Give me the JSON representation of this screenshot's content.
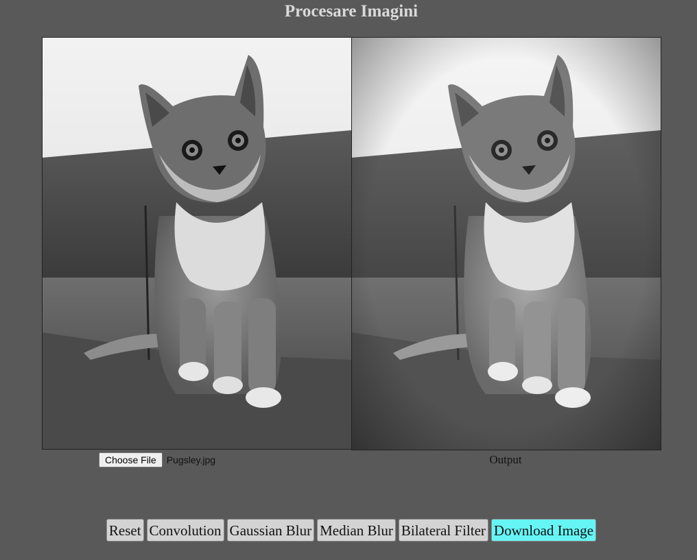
{
  "title": "Procesare Imagini",
  "input": {
    "choose_label": "Choose File",
    "file_name": "Pugsley.jpg"
  },
  "output": {
    "label": "Output"
  },
  "toolbar": {
    "buttons": [
      "Reset",
      "Convolution",
      "Gaussian Blur",
      "Median Blur",
      "Bilateral Filter",
      "Download Image"
    ]
  },
  "colors": {
    "background": "#595959",
    "accent_button": "#66f5f5",
    "button": "#d3d3d3"
  }
}
